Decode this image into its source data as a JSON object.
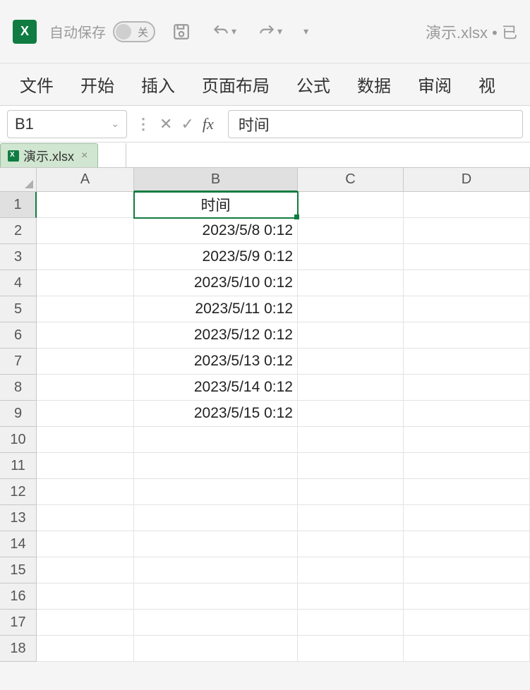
{
  "titlebar": {
    "autosave_label": "自动保存",
    "toggle_state": "关",
    "filename": "演示.xlsx",
    "status_suffix": "• 已"
  },
  "ribbon": {
    "tabs": [
      "文件",
      "开始",
      "插入",
      "页面布局",
      "公式",
      "数据",
      "审阅",
      "视"
    ]
  },
  "formula_bar": {
    "name_box": "B1",
    "formula": "时间"
  },
  "sheet_tab": {
    "name": "演示.xlsx"
  },
  "columns": [
    "A",
    "B",
    "C",
    "D"
  ],
  "rows": [
    "1",
    "2",
    "3",
    "4",
    "5",
    "6",
    "7",
    "8",
    "9",
    "10",
    "11",
    "12",
    "13",
    "14",
    "15",
    "16",
    "17",
    "18"
  ],
  "selected_cell": "B1",
  "cells": {
    "B1": "时间",
    "B2": "2023/5/8 0:12",
    "B3": "2023/5/9 0:12",
    "B4": "2023/5/10 0:12",
    "B5": "2023/5/11 0:12",
    "B6": "2023/5/12 0:12",
    "B7": "2023/5/13 0:12",
    "B8": "2023/5/14 0:12",
    "B9": "2023/5/15 0:12"
  }
}
